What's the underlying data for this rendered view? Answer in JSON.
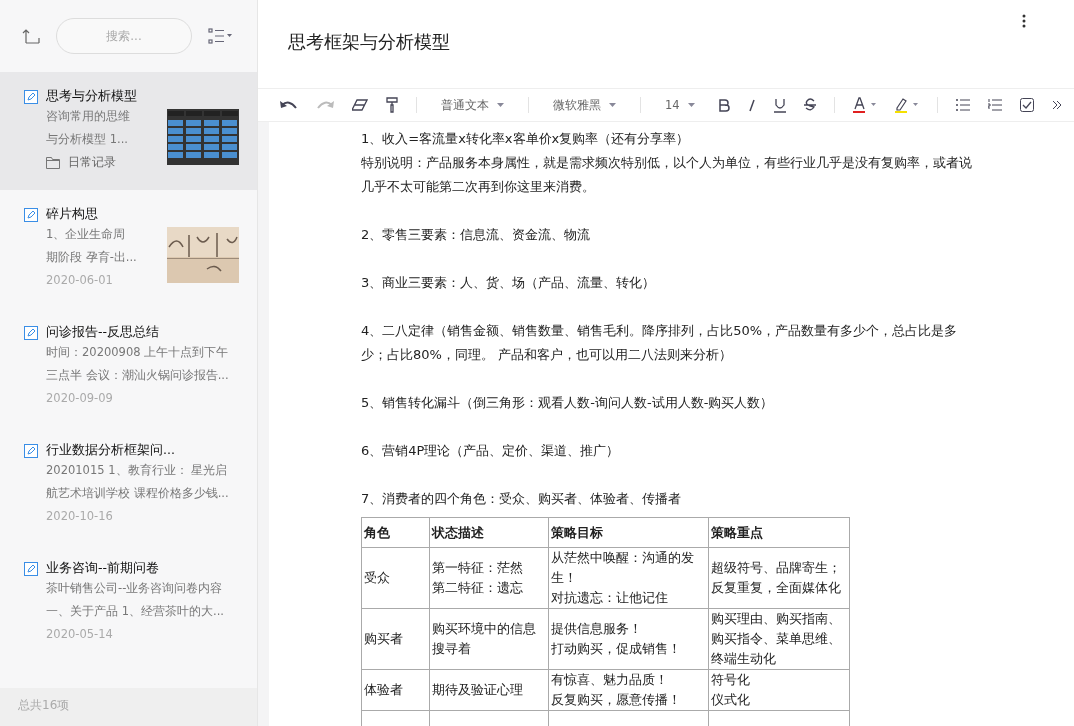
{
  "search": {
    "placeholder": "搜索..."
  },
  "notes": [
    {
      "title": "思考与分析模型",
      "snippet": [
        "咨询常用的思维",
        "与分析模型 1..."
      ],
      "folder": "日常记录",
      "selected": true,
      "kind": "picture"
    },
    {
      "title": "碎片构思",
      "snippet": [
        "1、企业生命周",
        "期阶段 孕育-出..."
      ],
      "date": "2020-06-01",
      "selected": false,
      "kind": "picture"
    },
    {
      "title": "问诊报告--反思总结",
      "snippet": [
        "时间：20200908 上午十点到下午",
        "三点半 会议：潮汕火锅问诊报告..."
      ],
      "date": "2020-09-09",
      "selected": false
    },
    {
      "title": "行业数据分析框架问...",
      "snippet": [
        "20201015 1、教育行业： 星光启",
        "航艺术培训学校 课程价格多少钱..."
      ],
      "date": "2020-10-16",
      "selected": false
    },
    {
      "title": "业务咨询--前期问卷",
      "snippet": [
        "茶叶销售公司--业务咨询问卷内容",
        "一、关于产品 1、经营茶叶的大..."
      ],
      "date": "2020-05-14",
      "selected": false
    }
  ],
  "count": "总共16项",
  "document": {
    "title": "思考框架与分析模型"
  },
  "toolbar": {
    "style": "普通文本",
    "font": "微软雅黑",
    "size": "14"
  },
  "paragraphs": [
    [
      "1、收入=客流量x转化率x客单价x复购率（还有分享率）",
      "特别说明：产品服务本身属性，就是需求频次特别低，以个人为单位，有些行业几乎是没有复购率，或者说几乎不太可能第二次再到你这里来消费。"
    ],
    [
      "2、零售三要素：信息流、资金流、物流"
    ],
    [
      "3、商业三要素：人、货、场（产品、流量、转化）"
    ],
    [
      "4、二八定律（销售金额、销售数量、销售毛利。降序排列，占比50%，产品数量有多少个，总占比是多少；占比80%，同理。  产品和客户，也可以用二八法则来分析）"
    ],
    [
      "5、销售转化漏斗（倒三角形：观看人数-询问人数-试用人数-购买人数）"
    ],
    [
      "6、营销4P理论（产品、定价、渠道、推广）"
    ],
    [
      "7、消费者的四个角色：受众、购买者、体验者、传播者"
    ]
  ],
  "table": {
    "columns": [
      "角色",
      "状态描述",
      "策略目标",
      "策略重点"
    ],
    "rows": [
      [
        [
          "受众"
        ],
        [
          "第一特征：茫然",
          "第二特征：遗忘"
        ],
        [
          "从茫然中唤醒：沟通的发生！",
          "对抗遗忘：让他记住"
        ],
        [
          "超级符号、品牌寄生；",
          "反复重复，全面媒体化"
        ]
      ],
      [
        [
          "购买者"
        ],
        [
          "购买环境中的信息搜寻着"
        ],
        [
          "提供信息服务！",
          "打动购买，促成销售！"
        ],
        [
          "购买理由、购买指南、购买指令、菜单思维、终端生动化"
        ]
      ],
      [
        [
          "体验者"
        ],
        [
          "期待及验证心理"
        ],
        [
          "有惊喜、魅力品质！",
          "反复购买，愿意传播！"
        ],
        [
          "符号化",
          "仪式化"
        ]
      ]
    ]
  }
}
